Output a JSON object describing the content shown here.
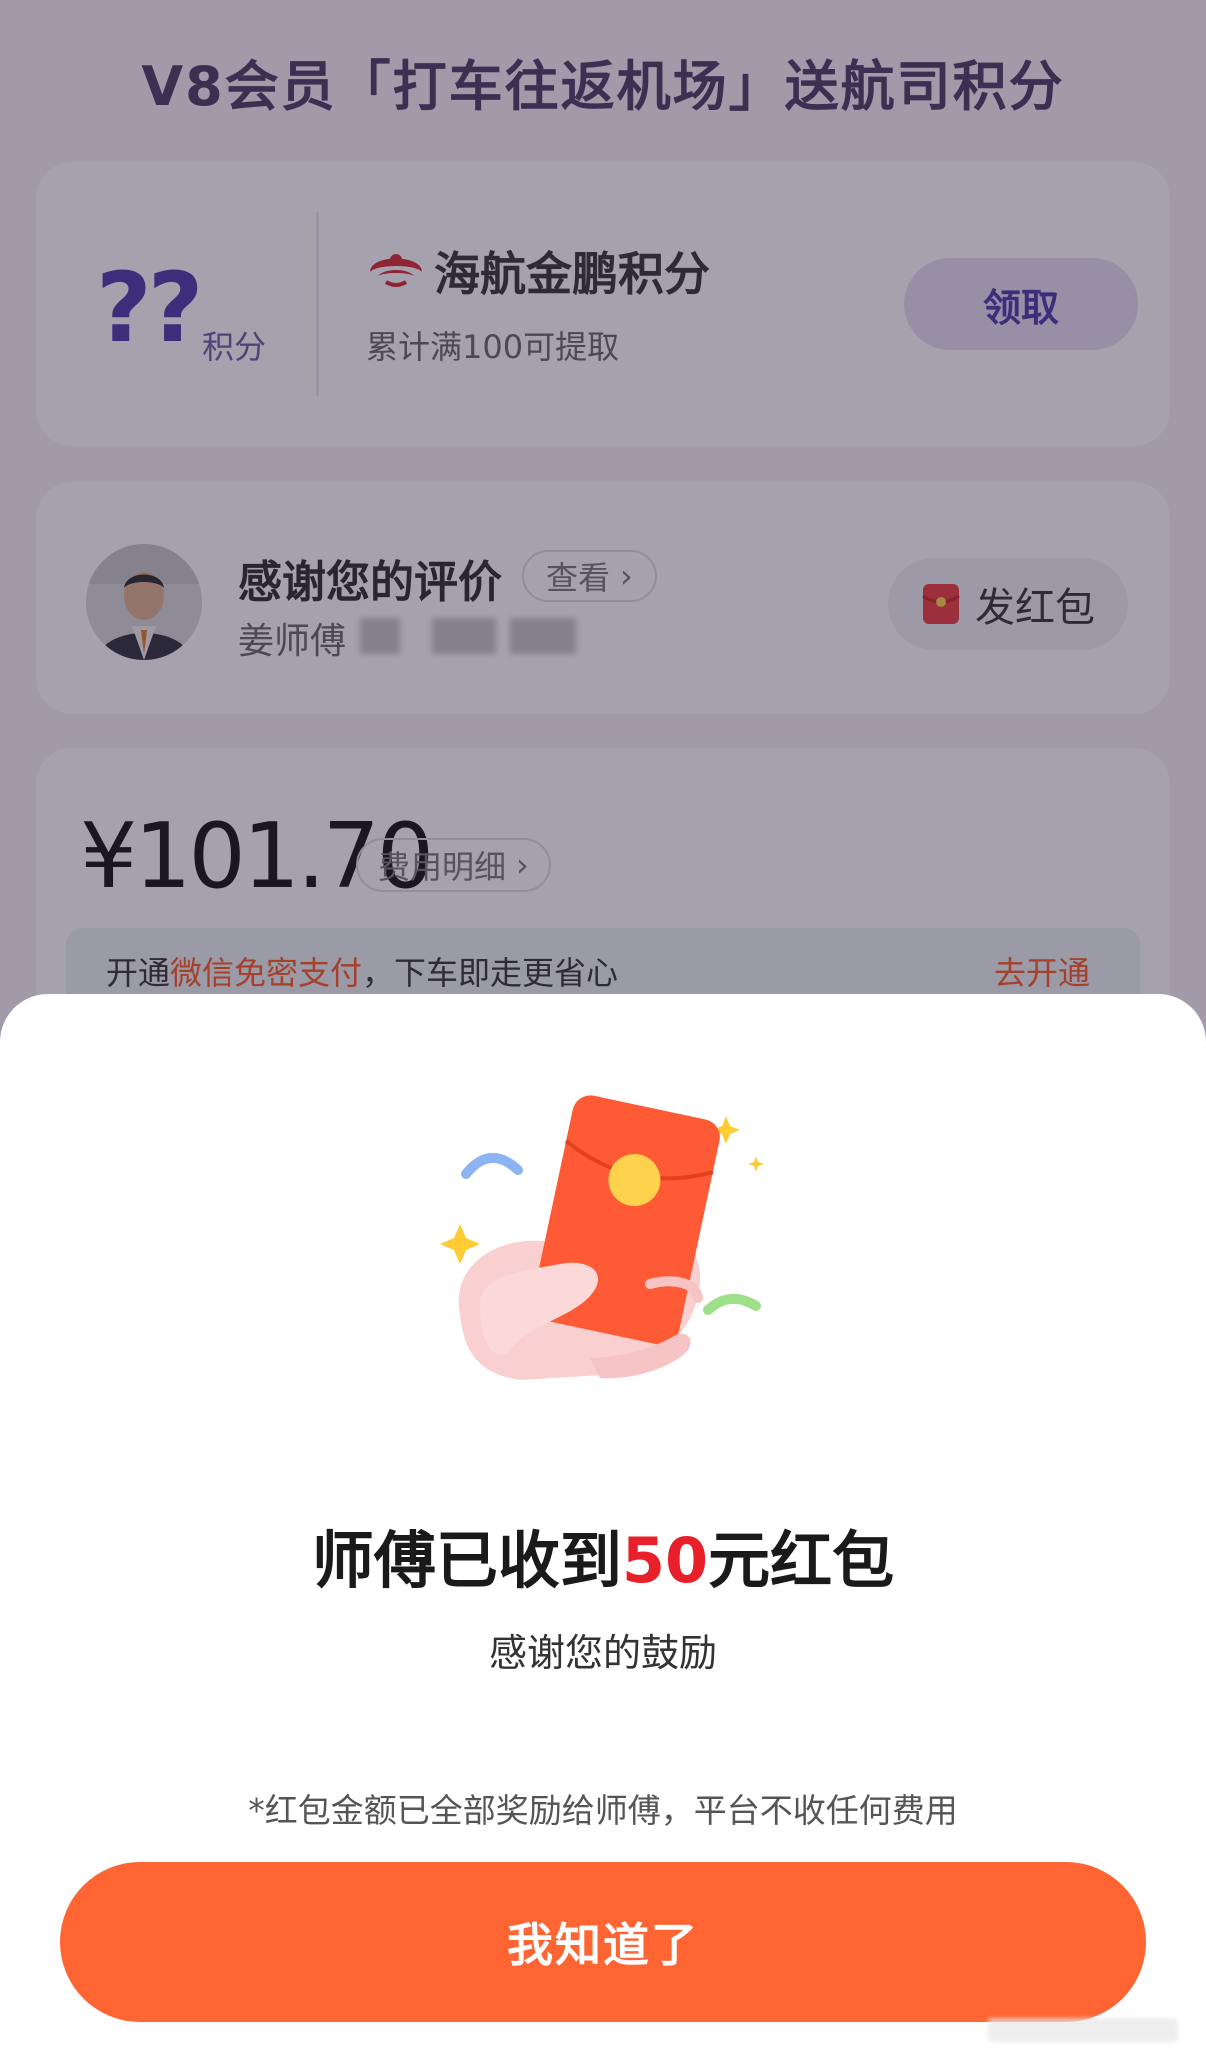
{
  "background": {
    "promo_title": "V8会员「打车往返机场」送航司积分",
    "points_card": {
      "points_value": "??",
      "points_unit": "积分",
      "brand": "海航金鹏积分",
      "description": "累计满100可提取",
      "claim_label": "领取"
    },
    "driver_card": {
      "thanks_text": "感谢您的评价",
      "view_label": "查看",
      "driver_name": "姜师傅",
      "hongbao_label": "发红包"
    },
    "fee_card": {
      "amount": "¥101.70",
      "detail_label": "费用明细",
      "promo_prefix": "开通",
      "promo_highlight": "微信免密支付",
      "promo_suffix": "，下车即走更省心",
      "promo_link": "去开通"
    }
  },
  "sheet": {
    "title_prefix": "师傅已收到",
    "title_amount": "50",
    "title_suffix": "元红包",
    "subtitle": "感谢您的鼓励",
    "note": "*红包金额已全部奖励给师傅，平台不收任何费用",
    "confirm_label": "我知道了"
  },
  "colors": {
    "accent": "#ff6532",
    "amount_red": "#e8202a",
    "brand_purple": "#4a3aa8"
  }
}
